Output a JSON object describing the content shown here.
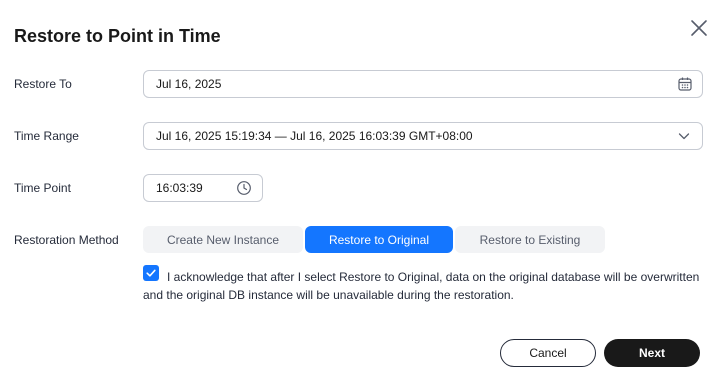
{
  "dialog": {
    "title": "Restore to Point in Time",
    "close_icon": "close-icon"
  },
  "form": {
    "restore_to": {
      "label": "Restore To",
      "value": "Jul 16, 2025",
      "icon": "calendar-icon"
    },
    "time_range": {
      "label": "Time Range",
      "value": "Jul 16, 2025 15:19:34 — Jul 16, 2025 16:03:39 GMT+08:00",
      "icon": "chevron-down-icon"
    },
    "time_point": {
      "label": "Time Point",
      "value": "16:03:39",
      "icon": "clock-icon"
    },
    "restoration_method": {
      "label": "Restoration Method",
      "options": [
        "Create New Instance",
        "Restore to Original",
        "Restore to Existing"
      ],
      "selected": "Restore to Original"
    },
    "acknowledge": {
      "checked": true,
      "text": "I acknowledge that after I select Restore to Original, data on the original database will be overwritten and the original DB instance will be unavailable during the restoration."
    }
  },
  "footer": {
    "cancel_label": "Cancel",
    "next_label": "Next"
  },
  "colors": {
    "accent": "#1476ff",
    "primary_button": "#191919",
    "segment_inactive": "#f2f3f5",
    "border": "#c7cbd3"
  }
}
